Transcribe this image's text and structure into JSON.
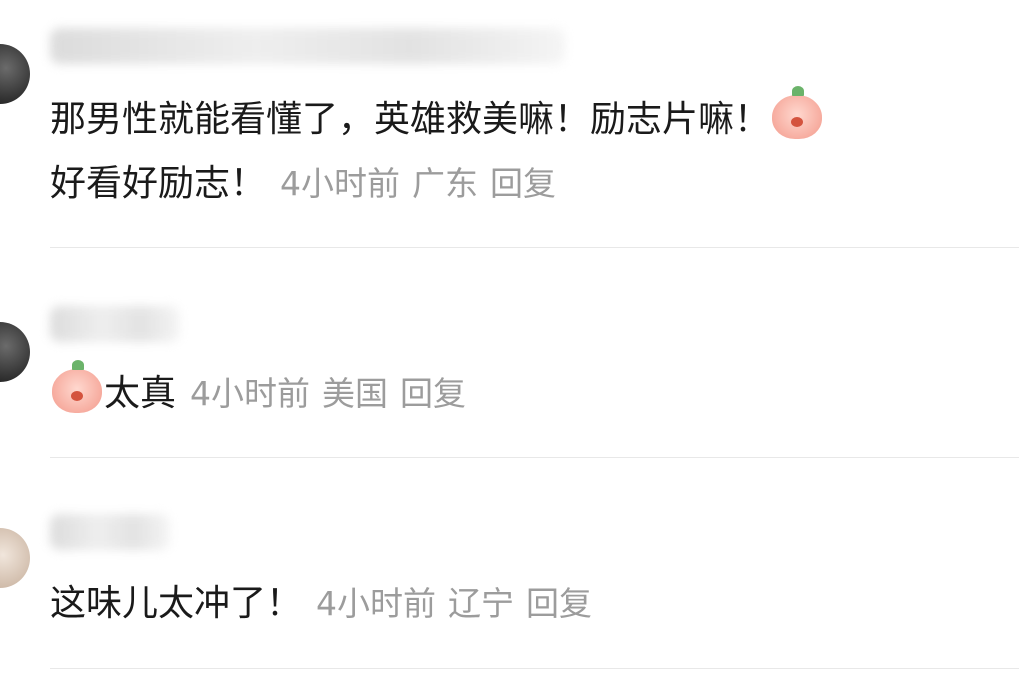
{
  "comments": [
    {
      "text_line1": "那男性就能看懂了，英雄救美嘛！励志片嘛！",
      "emoji1": "angry-face-emoji",
      "text_line2": "好看好励志！",
      "time": "4小时前",
      "location": "广东",
      "reply": "回复"
    },
    {
      "emoji": "blush-kiss-emoji",
      "text": "太真",
      "time": "4小时前",
      "location": "美国",
      "reply": "回复"
    },
    {
      "text": "这味儿太冲了！",
      "time": "4小时前",
      "location": "辽宁",
      "reply": "回复"
    }
  ]
}
